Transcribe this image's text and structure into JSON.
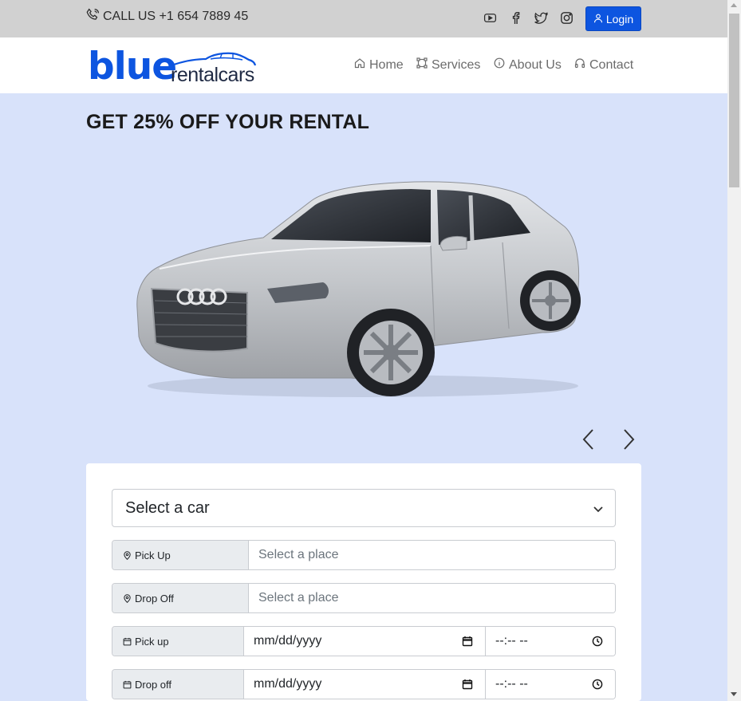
{
  "topbar": {
    "call_text": "CALL US +1 654 7889 45",
    "social_icons": [
      "youtube-icon",
      "facebook-icon",
      "twitter-icon",
      "instagram-icon"
    ],
    "login_label": "Login",
    "background": "#d1d1d1",
    "login_color": "#0d55e0"
  },
  "logo": {
    "word_blue": "blue",
    "word_rental": "rentalcars",
    "brand_color": "#0d55e0"
  },
  "nav": {
    "items": [
      {
        "label": "Home",
        "icon": "home-icon"
      },
      {
        "label": "Services",
        "icon": "services-icon"
      },
      {
        "label": "About Us",
        "icon": "info-icon"
      },
      {
        "label": "Contact",
        "icon": "headphones-icon"
      }
    ]
  },
  "hero": {
    "promo_text": "GET 25% OFF YOUR RENTAL",
    "background": "#d8e2fa",
    "image": "silver-sedan-car"
  },
  "booking": {
    "car_select": {
      "value": "Select a car"
    },
    "pickup_place": {
      "label": "Pick Up",
      "placeholder": "Select a place"
    },
    "dropoff_place": {
      "label": "Drop Off",
      "placeholder": "Select a place"
    },
    "pickup_datetime": {
      "label": "Pick up",
      "date_placeholder": "mm/dd/yyyy",
      "time_placeholder": "--:-- --"
    },
    "dropoff_datetime": {
      "label": "Drop off",
      "date_placeholder": "mm/dd/yyyy",
      "time_placeholder": "--:-- --"
    }
  }
}
